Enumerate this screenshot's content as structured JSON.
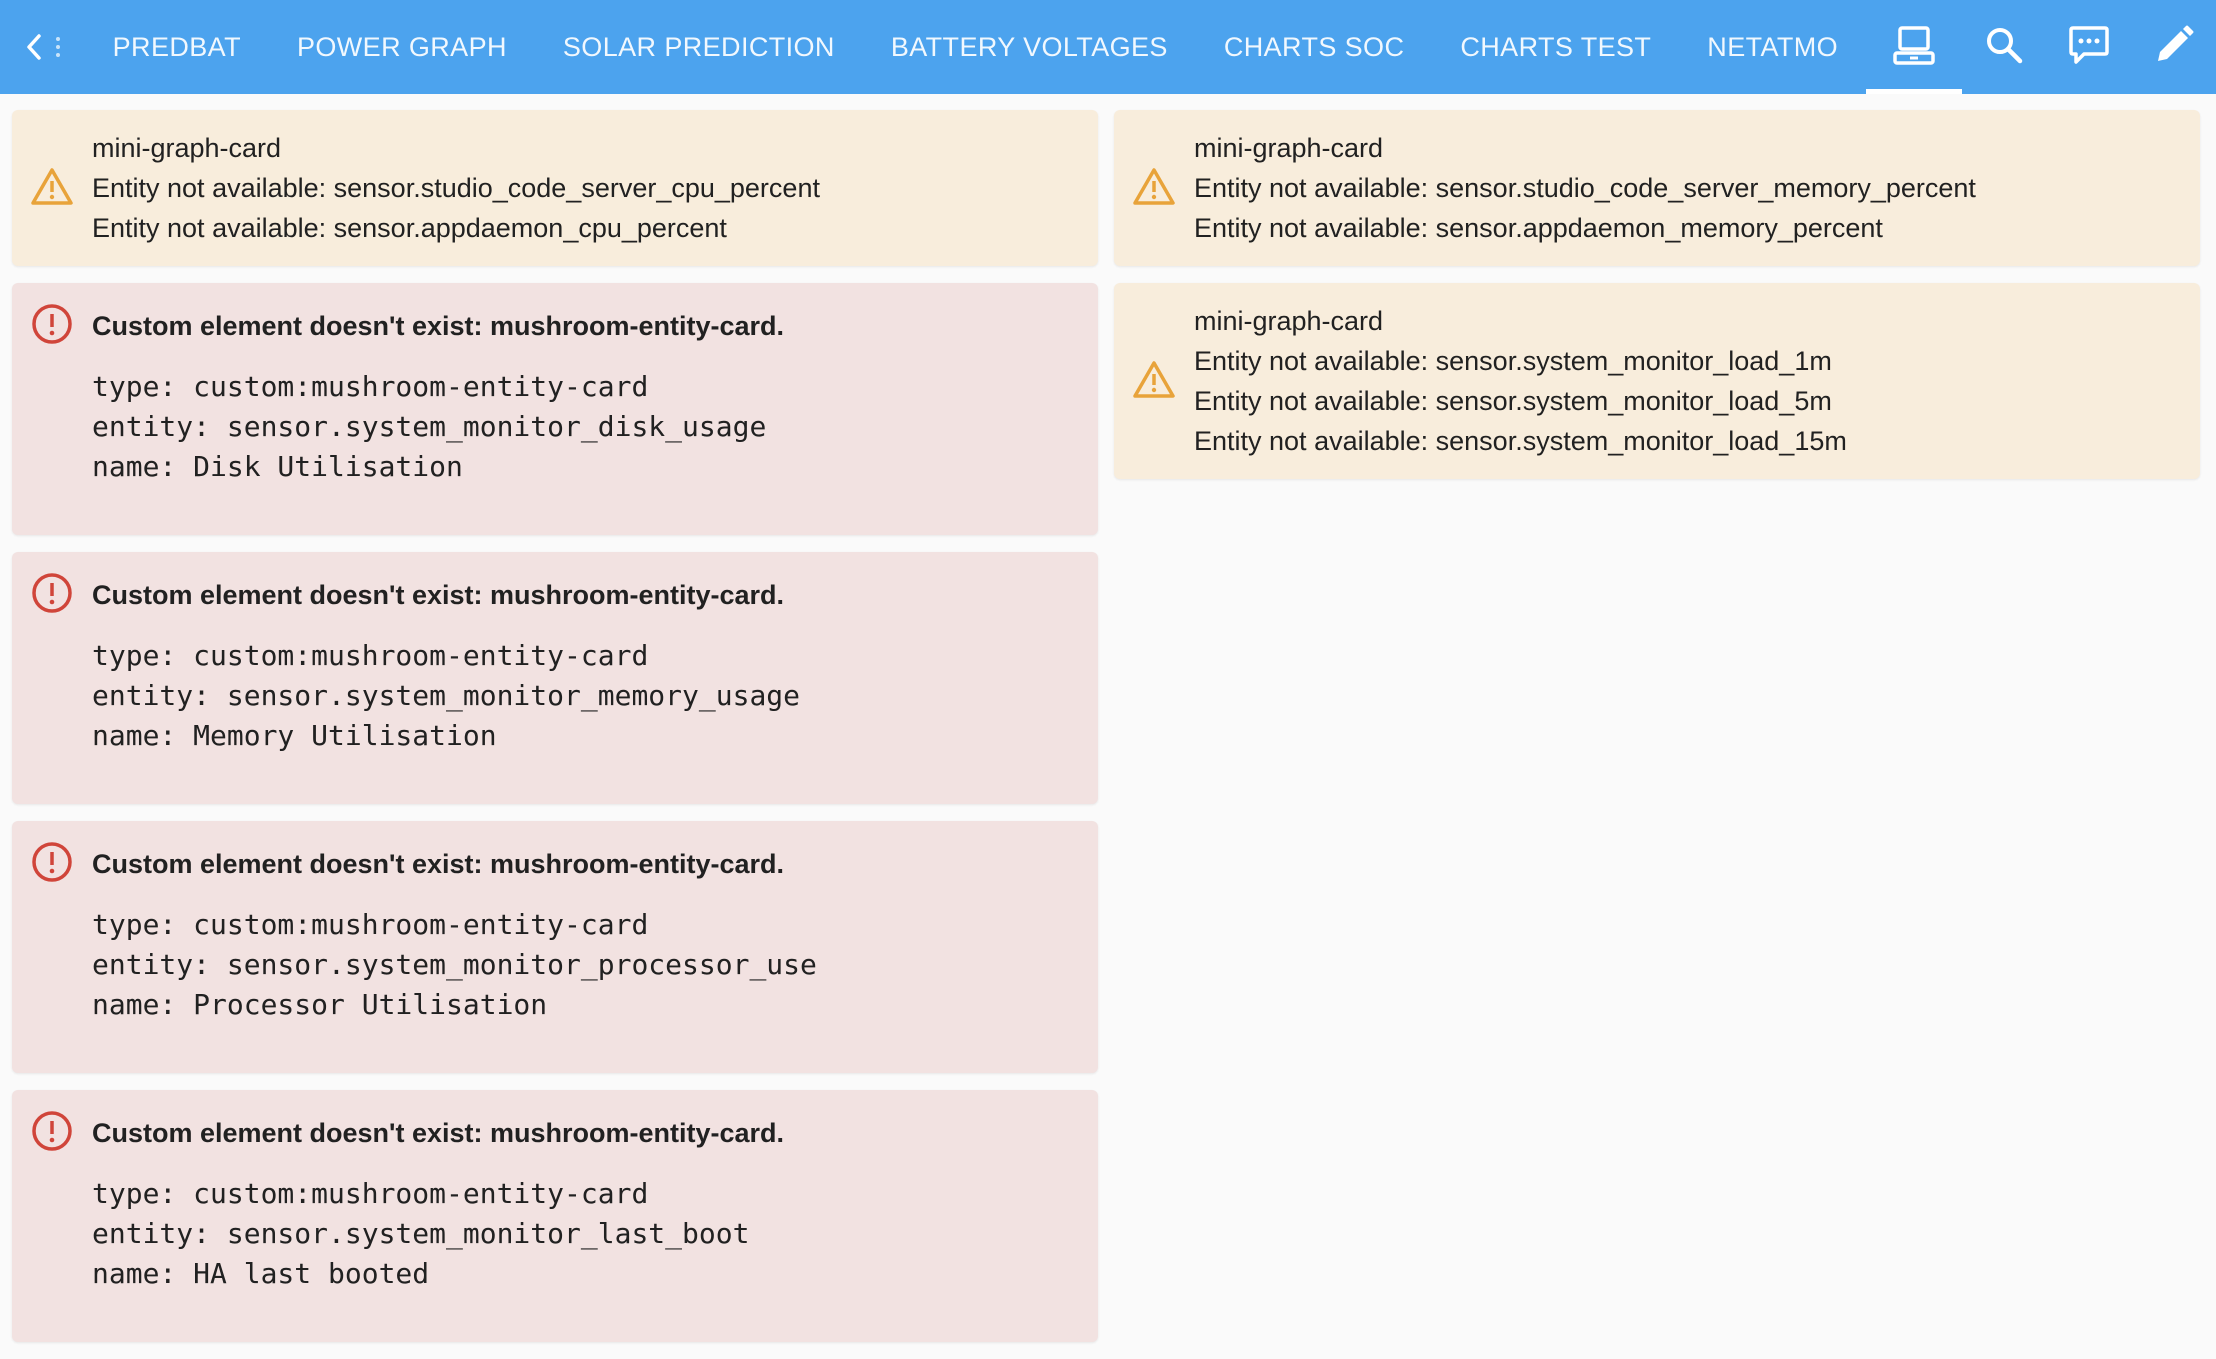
{
  "topbar": {
    "tabs": [
      {
        "label": "PREDBAT"
      },
      {
        "label": "POWER GRAPH"
      },
      {
        "label": "SOLAR PREDICTION"
      },
      {
        "label": "BATTERY VOLTAGES"
      },
      {
        "label": "CHARTS SOC"
      },
      {
        "label": "CHARTS TEST"
      },
      {
        "label": "NETATMO"
      }
    ],
    "active_tab_icon": "laptop-icon",
    "icons": [
      "chevron-left-icon",
      "laptop-icon",
      "search-icon",
      "chat-icon",
      "pencil-icon"
    ]
  },
  "colors": {
    "header": "#4ca3ee",
    "warning_bg": "#f8eddc",
    "warning_icon": "#e8a33a",
    "error_bg": "#f2e2e1",
    "error_icon": "#d0453a"
  },
  "cards": {
    "warn1": {
      "title": "mini-graph-card",
      "lines": [
        "Entity not available: sensor.studio_code_server_cpu_percent",
        "Entity not available: sensor.appdaemon_cpu_percent"
      ]
    },
    "warn2": {
      "title": "mini-graph-card",
      "lines": [
        "Entity not available: sensor.studio_code_server_memory_percent",
        "Entity not available: sensor.appdaemon_memory_percent"
      ]
    },
    "warn3": {
      "title": "mini-graph-card",
      "lines": [
        "Entity not available: sensor.system_monitor_load_1m",
        "Entity not available: sensor.system_monitor_load_5m",
        "Entity not available: sensor.system_monitor_load_15m"
      ]
    },
    "err1": {
      "title": "Custom element doesn't exist: mushroom-entity-card.",
      "lines": [
        "type: custom:mushroom-entity-card",
        "entity: sensor.system_monitor_disk_usage",
        "name: Disk Utilisation"
      ]
    },
    "err2": {
      "title": "Custom element doesn't exist: mushroom-entity-card.",
      "lines": [
        "type: custom:mushroom-entity-card",
        "entity: sensor.system_monitor_memory_usage",
        "name: Memory Utilisation"
      ]
    },
    "err3": {
      "title": "Custom element doesn't exist: mushroom-entity-card.",
      "lines": [
        "type: custom:mushroom-entity-card",
        "entity: sensor.system_monitor_processor_use",
        "name: Processor Utilisation"
      ]
    },
    "err4": {
      "title": "Custom element doesn't exist: mushroom-entity-card.",
      "lines": [
        "type: custom:mushroom-entity-card",
        "entity: sensor.system_monitor_last_boot",
        "name: HA last booted"
      ]
    }
  }
}
